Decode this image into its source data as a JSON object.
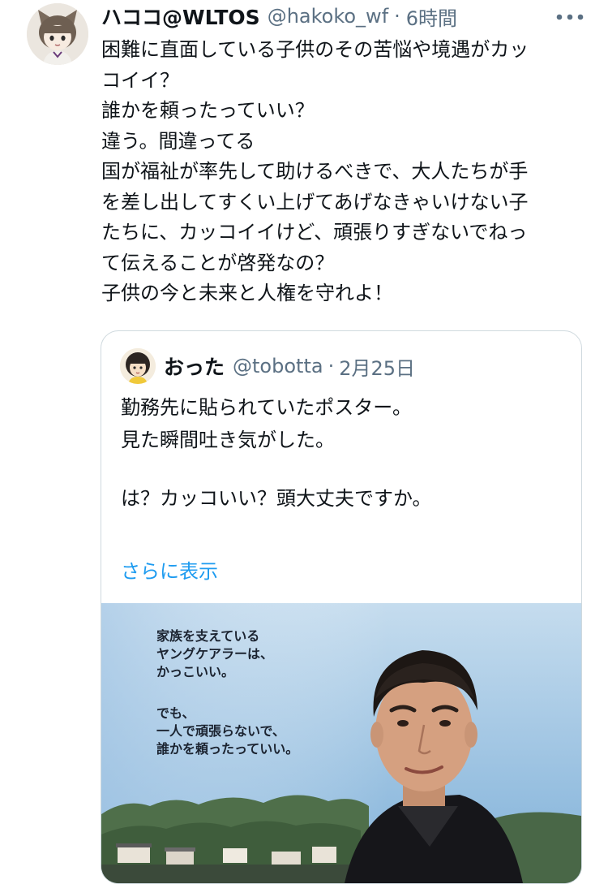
{
  "tweet": {
    "display_name": "ハココ@WLTOS",
    "handle": "@hakoko_wf",
    "separator": "·",
    "time": "6時間",
    "more_icon": "more-horizontal-icon",
    "text_lines": [
      "困難に直面している子供のその苦悩や境遇がカッ",
      "コイイ？",
      "誰かを頼ったっていい？",
      "違う。間違ってる",
      "国が福祉が率先して助けるべきで、大人たちが手",
      "を差し出してすくい上げてあげなきゃいけない子",
      "たちに、カッコイイけど、頑張りすぎないでねっ",
      "て伝えることが啓発なの？",
      "子供の今と未来と人権を守れよ！"
    ]
  },
  "quoted_tweet": {
    "display_name": "おった",
    "handle": "@tobotta",
    "separator": "·",
    "time": "2月25日",
    "text_lines": [
      "勤務先に貼られていたポスター。",
      "見た瞬間吐き気がした。",
      "",
      "は？カッコいい？頭大丈夫ですか。"
    ],
    "show_more": "さらに表示",
    "poster": {
      "block1": [
        "家族を支えている",
        "ヤングケアラーは、",
        "かっこいい。"
      ],
      "block2": [
        "でも、",
        "一人で頑張らないで、",
        "誰かを頼ったっていい。"
      ]
    }
  },
  "colors": {
    "text_primary": "#0f1419",
    "text_secondary": "#5b7083",
    "link": "#1d9bf0",
    "border": "#cfd9de",
    "sky_top": "#bcd6ea",
    "sky_bottom": "#7fb0d8"
  }
}
